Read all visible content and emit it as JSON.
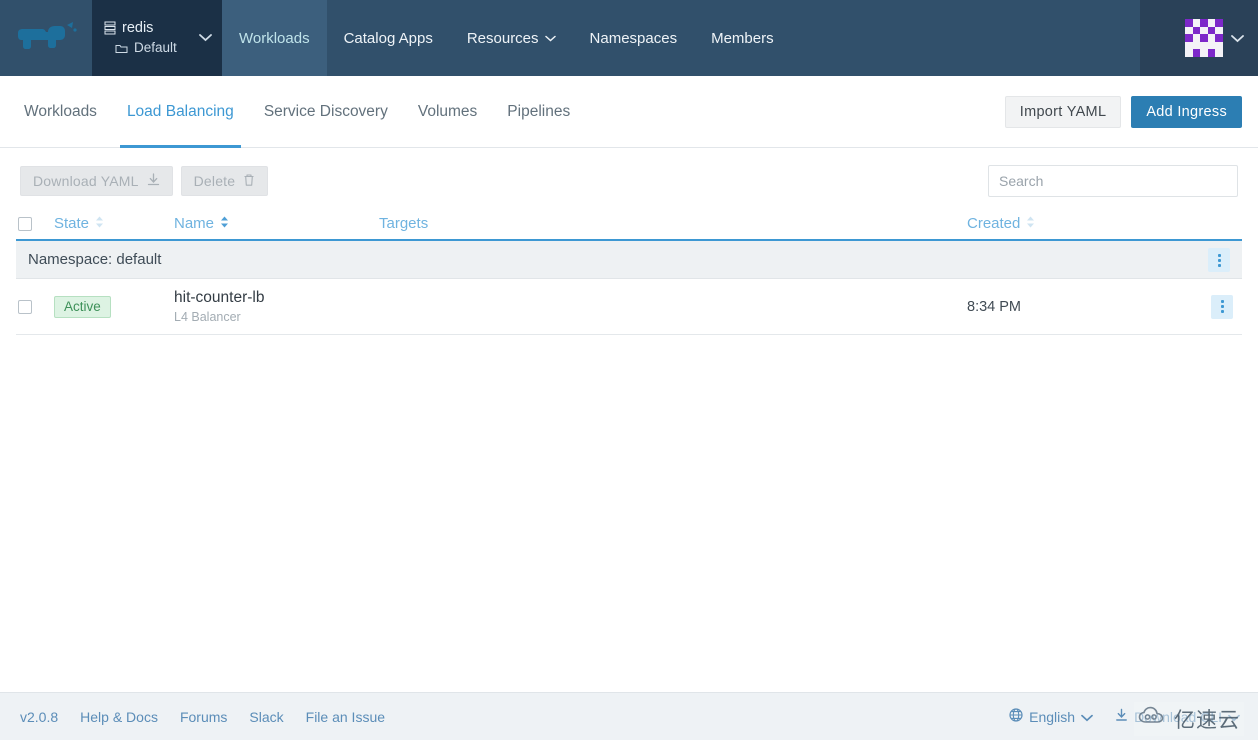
{
  "header": {
    "logo_icon": "rancher-cow-logo",
    "cluster": {
      "cluster_icon": "server-stack-icon",
      "cluster_name": "redis",
      "project_icon": "folder-icon",
      "project_name": "Default",
      "caret_icon": "chevron-down-icon"
    },
    "nav": [
      {
        "label": "Workloads",
        "active": true,
        "has_caret": false
      },
      {
        "label": "Catalog Apps",
        "active": false,
        "has_caret": false
      },
      {
        "label": "Resources",
        "active": false,
        "has_caret": true
      },
      {
        "label": "Namespaces",
        "active": false,
        "has_caret": false
      },
      {
        "label": "Members",
        "active": false,
        "has_caret": false
      }
    ],
    "user": {
      "avatar_icon": "user-identicon-avatar",
      "avatar_color": "#7d28c9",
      "caret_icon": "chevron-down-icon"
    }
  },
  "tabs": {
    "items": [
      {
        "label": "Workloads",
        "active": false
      },
      {
        "label": "Load Balancing",
        "active": true
      },
      {
        "label": "Service Discovery",
        "active": false
      },
      {
        "label": "Volumes",
        "active": false
      },
      {
        "label": "Pipelines",
        "active": false
      }
    ],
    "import_yaml_label": "Import YAML",
    "add_ingress_label": "Add Ingress",
    "accent_color": "#3d98d3",
    "primary_button_color": "#2c7eb3"
  },
  "toolbar": {
    "download_yaml_label": "Download YAML",
    "download_yaml_icon": "download-icon",
    "download_yaml_disabled": true,
    "delete_label": "Delete",
    "delete_icon": "trash-icon",
    "delete_disabled": true,
    "search_placeholder": "Search",
    "search_value": ""
  },
  "table": {
    "columns": [
      {
        "label": "State",
        "sortable": true,
        "sort_active": false
      },
      {
        "label": "Name",
        "sortable": true,
        "sort_active": true
      },
      {
        "label": "Targets",
        "sortable": false,
        "sort_active": false
      },
      {
        "label": "Created",
        "sortable": true,
        "sort_active": false
      }
    ],
    "select_all_icon": "checkbox-unchecked-icon",
    "groups": [
      {
        "label": "Namespace: default",
        "menu_icon": "kebab-menu-icon",
        "rows": [
          {
            "checkbox_icon": "checkbox-unchecked-icon",
            "state": "Active",
            "state_color": "#3e9159",
            "name": "hit-counter-lb",
            "type": "L4 Balancer",
            "targets": "",
            "created": "8:34 PM",
            "menu_icon": "kebab-menu-icon"
          }
        ]
      }
    ]
  },
  "footer": {
    "version": "v2.0.8",
    "links": [
      {
        "label": "Help & Docs"
      },
      {
        "label": "Forums"
      },
      {
        "label": "Slack"
      },
      {
        "label": "File an Issue"
      }
    ],
    "language": {
      "icon": "globe-icon",
      "label": "English",
      "caret_icon": "chevron-down-icon"
    },
    "cli": {
      "icon": "download-icon",
      "label": "Download CLI",
      "caret_icon": "chevron-down-icon"
    }
  },
  "watermark": {
    "icon": "cloud-logo-icon",
    "text": "亿速云"
  }
}
